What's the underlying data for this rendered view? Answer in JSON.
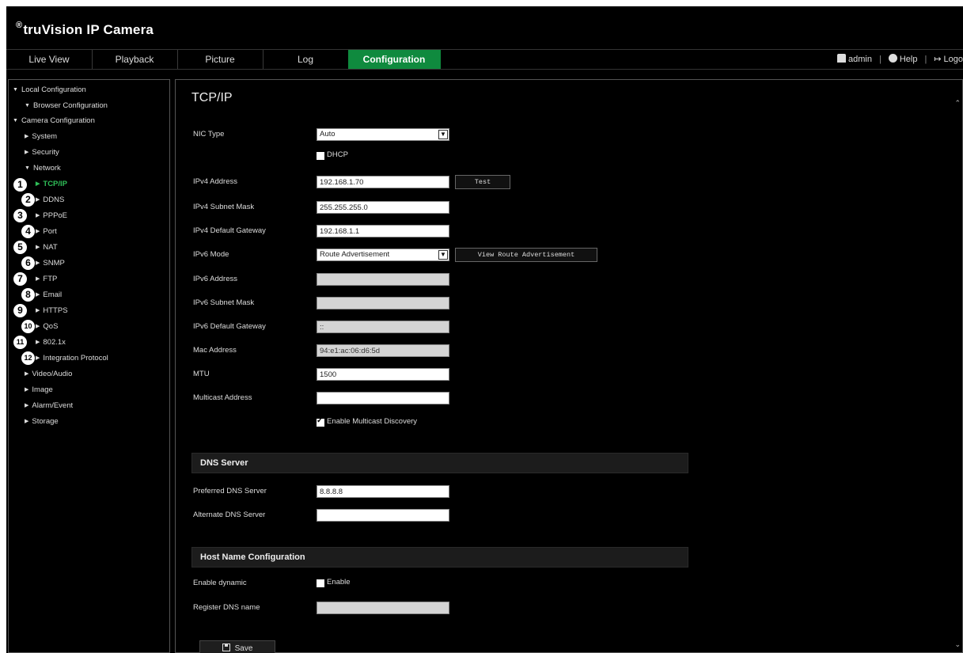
{
  "app": {
    "brand_mark": "®",
    "brand": "truVision IP Camera"
  },
  "nav": {
    "tabs": [
      {
        "label": "Live View"
      },
      {
        "label": "Playback"
      },
      {
        "label": "Picture"
      },
      {
        "label": "Log"
      },
      {
        "label": "Configuration"
      }
    ],
    "active_tab": "Configuration",
    "user": "admin",
    "help": "Help",
    "logout": "Logo",
    "separator": "|"
  },
  "sidebar": {
    "items": [
      {
        "label": "Local Configuration",
        "tri": "▼"
      },
      {
        "label": "Browser Configuration",
        "tri": "▼"
      },
      {
        "label": "Camera Configuration",
        "tri": "▼"
      },
      {
        "label": "System",
        "tri": "▶"
      },
      {
        "label": "Security",
        "tri": "▶"
      },
      {
        "label": "Network",
        "tri": "▼"
      },
      {
        "label": "TCP/IP",
        "tri": "▶",
        "callout": "1"
      },
      {
        "label": "DDNS",
        "tri": "▶",
        "callout": "2"
      },
      {
        "label": "PPPoE",
        "tri": "▶",
        "callout": "3"
      },
      {
        "label": "Port",
        "tri": "▶",
        "callout": "4"
      },
      {
        "label": "NAT",
        "tri": "▶",
        "callout": "5"
      },
      {
        "label": "SNMP",
        "tri": "▶",
        "callout": "6"
      },
      {
        "label": "FTP",
        "tri": "▶",
        "callout": "7"
      },
      {
        "label": "Email",
        "tri": "▶",
        "callout": "8"
      },
      {
        "label": "HTTPS",
        "tri": "▶",
        "callout": "9"
      },
      {
        "label": "QoS",
        "tri": "▶",
        "callout": "10"
      },
      {
        "label": "802.1x",
        "tri": "▶",
        "callout": "11"
      },
      {
        "label": "Integration Protocol",
        "tri": "▶",
        "callout": "12"
      },
      {
        "label": "Video/Audio",
        "tri": "▶"
      },
      {
        "label": "Image",
        "tri": "▶"
      },
      {
        "label": "Alarm/Event",
        "tri": "▶"
      },
      {
        "label": "Storage",
        "tri": "▶"
      }
    ],
    "active_item": "TCP/IP",
    "active_color": "#2fbf58"
  },
  "main": {
    "title": "TCP/IP",
    "nic_type": {
      "label": "NIC Type",
      "value": "Auto"
    },
    "dhcp": {
      "label": "DHCP",
      "checked": false
    },
    "ipv4_address": {
      "label": "IPv4 Address",
      "value": "192.168.1.70",
      "button": "Test"
    },
    "ipv4_subnet": {
      "label": "IPv4 Subnet Mask",
      "value": "255.255.255.0"
    },
    "ipv4_gateway": {
      "label": "IPv4 Default Gateway",
      "value": "192.168.1.1"
    },
    "ipv6_mode": {
      "label": "IPv6 Mode",
      "value": "Route Advertisement",
      "button": "View Route Advertisement"
    },
    "ipv6_address": {
      "label": "IPv6 Address",
      "value": ""
    },
    "ipv6_subnet": {
      "label": "IPv6 Subnet Mask",
      "value": ""
    },
    "ipv6_gateway": {
      "label": "IPv6 Default Gateway",
      "value": "::"
    },
    "mac_address": {
      "label": "Mac Address",
      "value": "94:e1:ac:06:d6:5d"
    },
    "mtu": {
      "label": "MTU",
      "value": "1500"
    },
    "multicast": {
      "label": "Multicast Address",
      "value": ""
    },
    "multicast_discovery": {
      "label": "Enable Multicast Discovery",
      "checked": true
    },
    "dns_section": "DNS Server",
    "preferred_dns": {
      "label": "Preferred DNS Server",
      "value": "8.8.8.8"
    },
    "alternate_dns": {
      "label": "Alternate DNS Server",
      "value": ""
    },
    "host_section": "Host Name Configuration",
    "enable_dynamic": {
      "label": "Enable dynamic",
      "checkbox_label": "Enable",
      "checked": false
    },
    "register_dns": {
      "label": "Register DNS name",
      "value": ""
    },
    "save": "Save"
  },
  "colors": {
    "accent": "#0f8a3e",
    "background": "#000000"
  }
}
